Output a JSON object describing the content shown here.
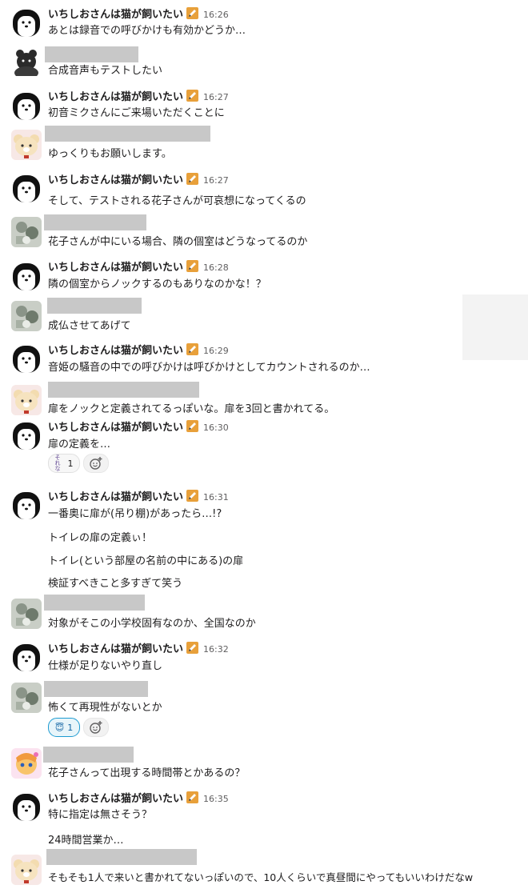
{
  "main_user": {
    "name": "いちしおさんは猫が飼いたい",
    "badge_icon": "pencil-badge-icon"
  },
  "messages": [
    {
      "kind": "main",
      "time": "16:26",
      "lines": [
        "あとは録音での呼びかけも有効かどうか…"
      ]
    },
    {
      "kind": "other",
      "avatar": "bear-icon",
      "lines": [
        "合成音声もテストしたい"
      ]
    },
    {
      "kind": "main",
      "time": "16:27",
      "lines": [
        "初音ミクさんにご来場いただくことに"
      ]
    },
    {
      "kind": "other",
      "avatar": "beige-bear-icon",
      "lines": [
        "ゆっくりもお願いします。"
      ]
    },
    {
      "kind": "main",
      "time": "16:27",
      "lines": [
        "そして、テストされる花子さんが可哀想になってくるの"
      ]
    },
    {
      "kind": "other",
      "avatar": "gray-photo-icon",
      "lines": [
        "花子さんが中にいる場合、隣の個室はどうなってるのか"
      ]
    },
    {
      "kind": "main",
      "time": "16:28",
      "lines": [
        "隣の個室からノックするのもありなのかな！？"
      ]
    },
    {
      "kind": "other",
      "avatar": "gray-photo-icon",
      "lines": [
        "成仏させてあげて"
      ]
    },
    {
      "kind": "main",
      "time": "16:29",
      "lines": [
        "音姫の騒音の中での呼びかけは呼びかけとしてカウントされるのか…"
      ]
    },
    {
      "kind": "other",
      "avatar": "beige-bear-icon",
      "lines": [
        "扉をノックと定義されてるっぽいな。扉を3回と書かれてる。"
      ]
    },
    {
      "kind": "main",
      "time": "16:30",
      "lines": [
        "扉の定義を…"
      ],
      "reaction": {
        "emoji": "それな",
        "count": "1"
      }
    },
    {
      "kind": "main",
      "time": "16:31",
      "lines": [
        "一番奥に扉が(吊り棚)があったら…!?",
        "トイレの扉の定義ぃ！",
        "トイレ(という部屋の名前の中にある)の扉",
        "検証すべきこと多すぎて笑う"
      ]
    },
    {
      "kind": "other",
      "avatar": "gray-photo-icon",
      "lines": [
        "対象がそこの小学校固有なのか、全国なのか"
      ]
    },
    {
      "kind": "main",
      "time": "16:32",
      "lines": [
        "仕様が足りないやり直し"
      ]
    },
    {
      "kind": "other",
      "avatar": "gray-photo-icon",
      "lines": [
        "怖くて再現性がないとか"
      ],
      "reaction": {
        "emoji": "😇",
        "count": "1"
      }
    },
    {
      "kind": "other",
      "avatar": "anime-avatar-icon",
      "lines": [
        "花子さんって出現する時間帯とかあるの？"
      ]
    },
    {
      "kind": "main",
      "time": "16:35",
      "lines": [
        "特に指定は無さそう？",
        "24時間営業か…"
      ]
    },
    {
      "kind": "other",
      "avatar": "beige-bear-icon",
      "lines": [
        "そもそも1人で来いと書かれてないっぽいので、10人くらいで真昼間にやってもいいわけだなw"
      ]
    }
  ]
}
